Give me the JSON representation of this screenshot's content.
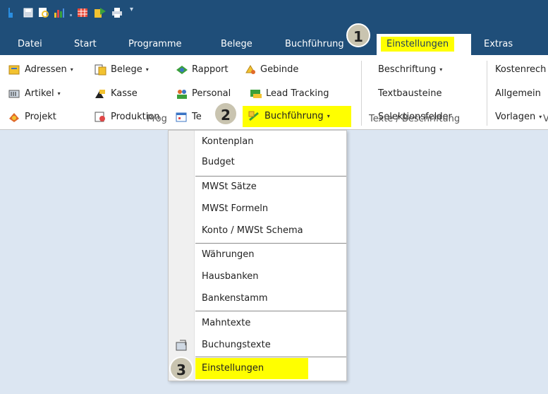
{
  "quick_access": {
    "icons": [
      "app-logo-icon",
      "save-icon",
      "print-preview-icon",
      "chart-icon",
      "table-icon",
      "import-icon",
      "printer-icon"
    ],
    "customize_arrow": "▾"
  },
  "tabs": [
    {
      "label": "Datei"
    },
    {
      "label": "Start"
    },
    {
      "label": "Programme"
    },
    {
      "label": "Belege"
    },
    {
      "label": "Buchführung"
    },
    {
      "label": "Einstellungen"
    },
    {
      "label": "Extras"
    }
  ],
  "ribbon": {
    "programme": {
      "adressen": "Adressen",
      "belege": "Belege",
      "rapport": "Rapport",
      "gebinde": "Gebinde",
      "artikel": "Artikel",
      "kasse": "Kasse",
      "personal": "Personal",
      "lead_tracking": "Lead Tracking",
      "projekt": "Projekt",
      "produktion": "Produktion",
      "termine": "Te",
      "termine_tail": "e",
      "buchfuehrung": "Buchführung",
      "group_label": "Prog"
    },
    "texte": {
      "beschriftung": "Beschriftung",
      "textbausteine": "Textbausteine",
      "selektionsfelder": "Selektionsfelder",
      "group_label": "Texte / Beschriftung"
    },
    "other": {
      "kostenrechnung": "Kostenrech",
      "allgemein": "Allgemein",
      "vorlagen": "Vorlagen",
      "group_label": "V"
    },
    "dropdown_arrow": "▾"
  },
  "menu": {
    "items": [
      "Kontenplan",
      "Budget",
      "MWSt Sätze",
      "MWSt Formeln",
      "Konto / MWSt Schema",
      "Währungen",
      "Hausbanken",
      "Bankenstamm",
      "Mahntexte",
      "Buchungstexte",
      "Einstellungen"
    ]
  },
  "callouts": [
    "1",
    "2",
    "3"
  ],
  "colors": {
    "title_bar": "#1f4e79",
    "highlight": "#ffff00",
    "workspace": "#dce6f2",
    "callout": "#c9c4b0"
  }
}
